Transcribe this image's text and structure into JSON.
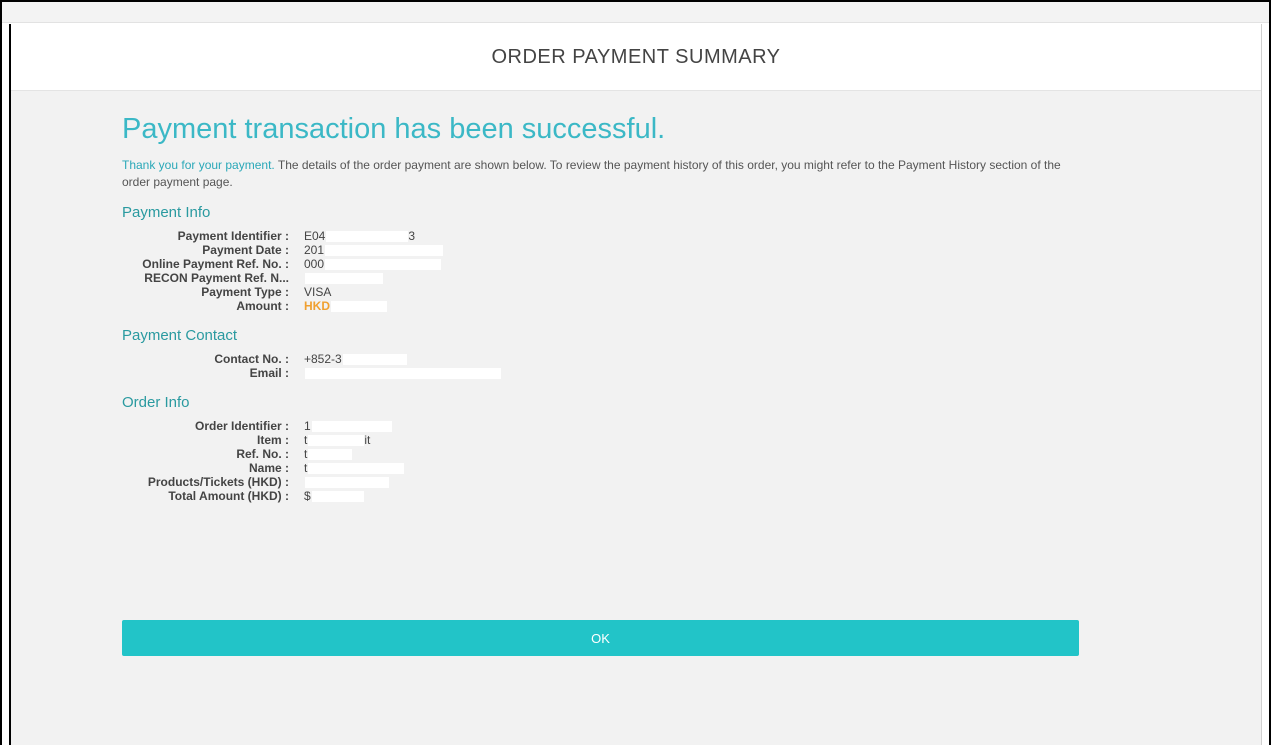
{
  "header": {
    "title": "ORDER PAYMENT SUMMARY"
  },
  "main": {
    "heading": "Payment transaction has been successful.",
    "intro_accent": "Thank you for your payment.",
    "intro_text": " The details of the order payment are shown below. To review the payment history of this order, you might refer to the Payment History section of the order payment page."
  },
  "payment_info": {
    "title": "Payment Info",
    "rows": [
      {
        "label": "Payment Identifier :",
        "value": "E04",
        "tail": "3"
      },
      {
        "label": "Payment Date :",
        "value": "201",
        "tail": ""
      },
      {
        "label": "Online Payment Ref. No. :",
        "value": "000",
        "tail": ""
      },
      {
        "label": "RECON Payment Ref. N...",
        "value": "",
        "tail": ""
      },
      {
        "label": "Payment Type :",
        "value": "VISA",
        "tail": ""
      },
      {
        "label": "Amount :",
        "value": "HKD",
        "tail": ""
      }
    ]
  },
  "payment_contact": {
    "title": "Payment Contact",
    "rows": [
      {
        "label": "Contact No. :",
        "value": "+852-3",
        "tail": ""
      },
      {
        "label": "Email :",
        "value": "",
        "tail": ""
      }
    ]
  },
  "order_info": {
    "title": "Order Info",
    "rows": [
      {
        "label": "Order Identifier :",
        "value": "1",
        "tail": ""
      },
      {
        "label": "Item :",
        "value": "t",
        "tail": "it"
      },
      {
        "label": "Ref. No. :",
        "value": "t",
        "tail": ""
      },
      {
        "label": "Name :",
        "value": "t",
        "tail": ""
      },
      {
        "label": "Products/Tickets (HKD) :",
        "value": "",
        "tail": ""
      },
      {
        "label": "Total Amount (HKD) :",
        "value": "$",
        "tail": ""
      }
    ]
  },
  "actions": {
    "ok_label": "OK"
  },
  "colors": {
    "accent_teal": "#3bb8c6",
    "section_teal": "#2a9aa0",
    "button": "#22c4c8",
    "amount_orange": "#f0a030"
  }
}
